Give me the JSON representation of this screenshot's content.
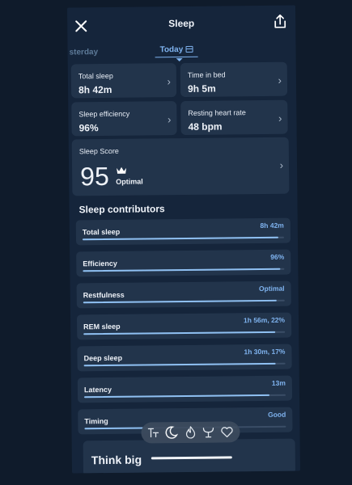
{
  "header": {
    "title": "Sleep"
  },
  "tabs": {
    "previous": "sterday",
    "current": "Today"
  },
  "summary": [
    {
      "label": "Total sleep",
      "value": "8h 42m"
    },
    {
      "label": "Time in bed",
      "value": "9h 5m"
    },
    {
      "label": "Sleep efficiency",
      "value": "96%"
    },
    {
      "label": "Resting heart rate",
      "value": "48 bpm"
    }
  ],
  "score": {
    "label": "Sleep Score",
    "value": "95",
    "rating": "Optimal"
  },
  "contributors": {
    "title": "Sleep contributors",
    "items": [
      {
        "label": "Total sleep",
        "value": "8h 42m",
        "fill": 0.97
      },
      {
        "label": "Efficiency",
        "value": "96%",
        "fill": 0.98
      },
      {
        "label": "Restfulness",
        "value": "Optimal",
        "fill": 0.96
      },
      {
        "label": "REM sleep",
        "value": "1h 56m, 22%",
        "fill": 0.95
      },
      {
        "label": "Deep sleep",
        "value": "1h 30m, 17%",
        "fill": 0.95
      },
      {
        "label": "Latency",
        "value": "13m",
        "fill": 0.92
      },
      {
        "label": "Timing",
        "value": "Good",
        "fill": 0.76
      }
    ]
  },
  "next_card": {
    "title": "Think big"
  },
  "bottom_nav": [
    "readiness-icon",
    "sleep-moon-icon",
    "activity-flame-icon",
    "vitals-icon",
    "heart-icon"
  ],
  "colors": {
    "background": "#0f1b2b",
    "screen": "#15253b",
    "card": "#22344b",
    "accent": "#7fb3ef"
  }
}
